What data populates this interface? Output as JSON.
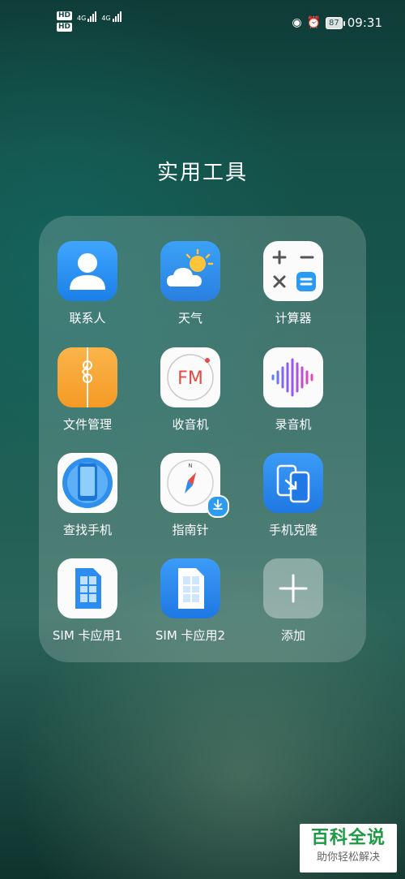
{
  "status_bar": {
    "hd_badge_1": "HD",
    "hd_badge_2": "HD",
    "network_1": "4G",
    "network_2": "4G",
    "battery": "87",
    "time": "09:31"
  },
  "folder": {
    "title": "实用工具",
    "apps": [
      {
        "label": "联系人",
        "icon": "contacts-icon"
      },
      {
        "label": "天气",
        "icon": "weather-icon"
      },
      {
        "label": "计算器",
        "icon": "calculator-icon"
      },
      {
        "label": "文件管理",
        "icon": "files-icon"
      },
      {
        "label": "收音机",
        "icon": "radio-icon",
        "icon_text": "FM"
      },
      {
        "label": "录音机",
        "icon": "recorder-icon"
      },
      {
        "label": "查找手机",
        "icon": "find-phone-icon"
      },
      {
        "label": "指南针",
        "icon": "compass-icon",
        "icon_text": "N"
      },
      {
        "label": "手机克隆",
        "icon": "phone-clone-icon"
      },
      {
        "label": "SIM 卡应用1",
        "icon": "sim-card-icon"
      },
      {
        "label": "SIM 卡应用2",
        "icon": "sim-card-icon"
      },
      {
        "label": "添加",
        "icon": "add-icon"
      }
    ]
  },
  "watermark": {
    "main": "百科全说",
    "sub": "助你轻松解决"
  },
  "colors": {
    "accent_blue": "#2d8cf0",
    "files_orange": "#f9a93a",
    "recorder_purple": "#8a5cf5",
    "radio_red": "#e84a43",
    "watermark_green": "#1e9a45"
  }
}
